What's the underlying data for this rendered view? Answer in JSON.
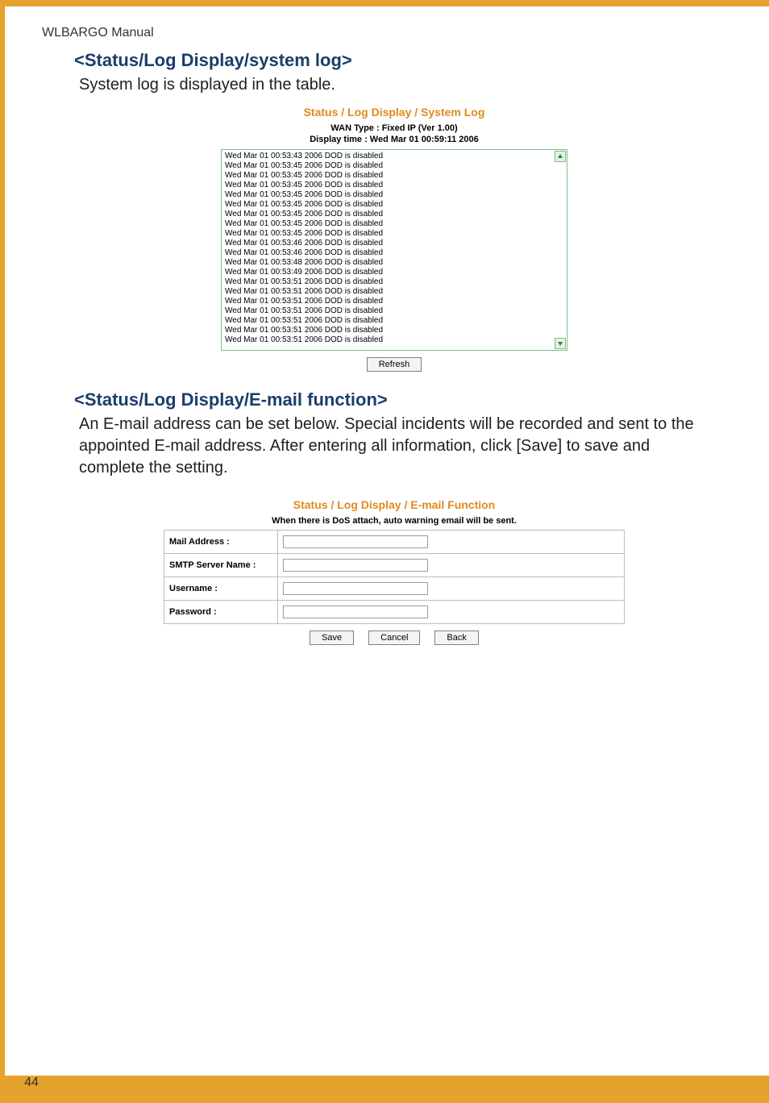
{
  "doc_header": "WLBARGO Manual",
  "page_number": "44",
  "section1": {
    "heading": "<Status/Log Display/system log>",
    "text": "System log is displayed in the table.",
    "breadcrumb": "Status / Log Display / System Log",
    "wan_type": "WAN Type : Fixed IP (Ver 1.00)",
    "display_time": "Display time : Wed Mar 01 00:59:11 2006",
    "log_lines": [
      "Wed Mar 01 00:53:43 2006 DOD is disabled",
      "Wed Mar 01 00:53:45 2006 DOD is disabled",
      "Wed Mar 01 00:53:45 2006 DOD is disabled",
      "Wed Mar 01 00:53:45 2006 DOD is disabled",
      "Wed Mar 01 00:53:45 2006 DOD is disabled",
      "Wed Mar 01 00:53:45 2006 DOD is disabled",
      "Wed Mar 01 00:53:45 2006 DOD is disabled",
      "Wed Mar 01 00:53:45 2006 DOD is disabled",
      "Wed Mar 01 00:53:45 2006 DOD is disabled",
      "Wed Mar 01 00:53:46 2006 DOD is disabled",
      "Wed Mar 01 00:53:46 2006 DOD is disabled",
      "Wed Mar 01 00:53:48 2006 DOD is disabled",
      "Wed Mar 01 00:53:49 2006 DOD is disabled",
      "Wed Mar 01 00:53:51 2006 DOD is disabled",
      "Wed Mar 01 00:53:51 2006 DOD is disabled",
      "Wed Mar 01 00:53:51 2006 DOD is disabled",
      "Wed Mar 01 00:53:51 2006 DOD is disabled",
      "Wed Mar 01 00:53:51 2006 DOD is disabled",
      "Wed Mar 01 00:53:51 2006 DOD is disabled",
      "Wed Mar 01 00:53:51 2006 DOD is disabled"
    ],
    "refresh_label": "Refresh"
  },
  "section2": {
    "heading": "<Status/Log Display/E-mail function>",
    "text": "An E-mail address can be set below.  Special incidents will be recorded and sent to the appointed E-mail address.  After entering all information, click [Save] to save and complete the setting.",
    "breadcrumb": "Status / Log Display / E-mail Function",
    "intro": "When there is DoS attach, auto warning email will be sent.",
    "fields": {
      "mail": "Mail Address :",
      "smtp": "SMTP Server Name :",
      "user": "Username :",
      "pass": "Password :"
    },
    "buttons": {
      "save": "Save",
      "cancel": "Cancel",
      "back": "Back"
    }
  }
}
